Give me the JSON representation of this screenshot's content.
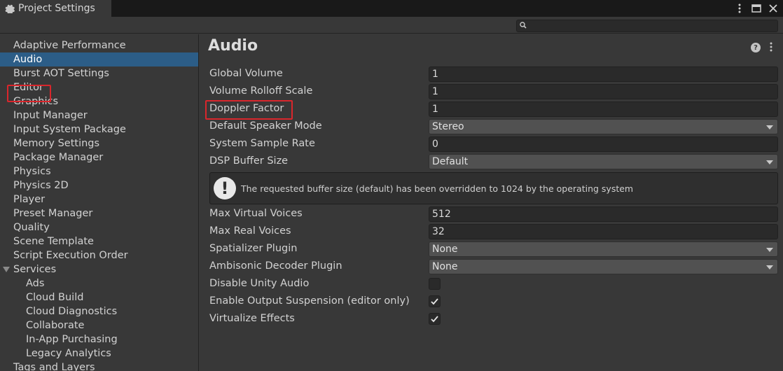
{
  "window": {
    "tab_title": "Project Settings",
    "controls": [
      "more-icon",
      "maximize-icon",
      "close-icon"
    ]
  },
  "search": {
    "placeholder": "",
    "value": ""
  },
  "sidebar": {
    "items": [
      {
        "label": "Adaptive Performance"
      },
      {
        "label": "Audio",
        "selected": true
      },
      {
        "label": "Burst AOT Settings"
      },
      {
        "label": "Editor"
      },
      {
        "label": "Graphics"
      },
      {
        "label": "Input Manager"
      },
      {
        "label": "Input System Package"
      },
      {
        "label": "Memory Settings"
      },
      {
        "label": "Package Manager"
      },
      {
        "label": "Physics"
      },
      {
        "label": "Physics 2D"
      },
      {
        "label": "Player"
      },
      {
        "label": "Preset Manager"
      },
      {
        "label": "Quality"
      },
      {
        "label": "Scene Template"
      },
      {
        "label": "Script Execution Order"
      },
      {
        "label": "Services",
        "expanded": true
      },
      {
        "label": "Ads",
        "child": true
      },
      {
        "label": "Cloud Build",
        "child": true
      },
      {
        "label": "Cloud Diagnostics",
        "child": true
      },
      {
        "label": "Collaborate",
        "child": true
      },
      {
        "label": "In-App Purchasing",
        "child": true
      },
      {
        "label": "Legacy Analytics",
        "child": true
      },
      {
        "label": "Tags and Layers"
      }
    ]
  },
  "main": {
    "title": "Audio",
    "fields": {
      "global_volume": {
        "label": "Global Volume",
        "value": "1"
      },
      "volume_rolloff_scale": {
        "label": "Volume Rolloff Scale",
        "value": "1"
      },
      "doppler_factor": {
        "label": "Doppler Factor",
        "value": "1"
      },
      "default_speaker_mode": {
        "label": "Default Speaker Mode",
        "value": "Stereo"
      },
      "system_sample_rate": {
        "label": "System Sample Rate",
        "value": "0"
      },
      "dsp_buffer_size": {
        "label": "DSP Buffer Size",
        "value": "Default"
      },
      "max_virtual_voices": {
        "label": "Max Virtual Voices",
        "value": "512"
      },
      "max_real_voices": {
        "label": "Max Real Voices",
        "value": "32"
      },
      "spatializer_plugin": {
        "label": "Spatializer Plugin",
        "value": "None"
      },
      "ambisonic_decoder_plugin": {
        "label": "Ambisonic Decoder Plugin",
        "value": "None"
      },
      "disable_unity_audio": {
        "label": "Disable Unity Audio",
        "checked": false
      },
      "enable_output_suspension": {
        "label": "Enable Output Suspension (editor only)",
        "checked": true
      },
      "virtualize_effects": {
        "label": "Virtualize Effects",
        "checked": true
      }
    },
    "warning": "The requested buffer size (default) has been overridden to 1024 by the operating system"
  },
  "colors": {
    "selection": "#2c5d87",
    "highlight": "#d9262c",
    "background": "#383838"
  }
}
